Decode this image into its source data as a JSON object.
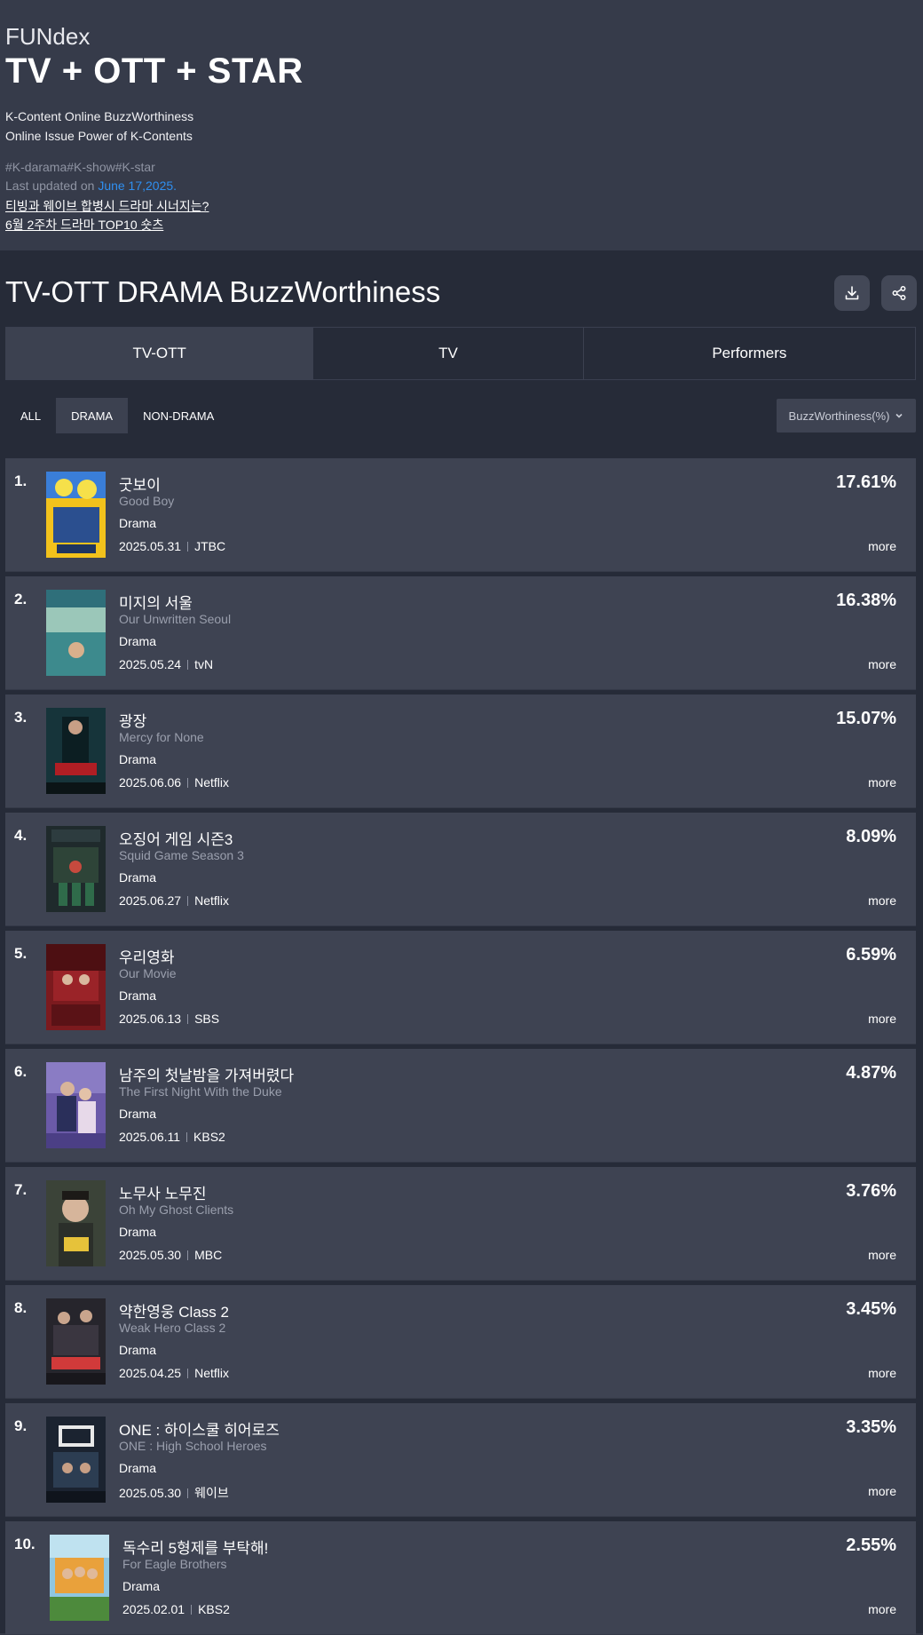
{
  "header": {
    "brand": "FUNdex",
    "title": "TV + OTT + STAR",
    "subtitle_1": "K-Content Online BuzzWorthiness",
    "subtitle_2": "Online Issue Power of K-Contents",
    "tags": "#K-darama#K-show#K-star",
    "updated_prefix": "Last updated on ",
    "updated_date": "June 17,2025.",
    "link_1": "티빙과 웨이브 합병시 드라마 시너지는?",
    "link_2": "6월 2주차 드라마 TOP10 숏츠"
  },
  "board": {
    "title": "TV-OTT DRAMA BuzzWorthiness",
    "download_icon": "download-icon",
    "share_icon": "share-icon",
    "main_tabs": [
      "TV-OTT",
      "TV",
      "Performers"
    ],
    "active_main_tab": "TV-OTT",
    "sub_tabs": [
      "ALL",
      "DRAMA",
      "NON-DRAMA"
    ],
    "active_sub_tab": "DRAMA",
    "sort_label": "BuzzWorthiness(%)"
  },
  "colors": {
    "header_bg": "#363b4a",
    "board_bg": "#262b38",
    "row_bg": "#3e4352",
    "accent_link": "#2f8ff0"
  },
  "list": {
    "more_label": "more",
    "items": [
      {
        "rank": "1.",
        "title_ko": "굿보이",
        "title_en": "Good Boy",
        "genre": "Drama",
        "date": "2025.05.31",
        "channel": "JTBC",
        "pct": "17.61%"
      },
      {
        "rank": "2.",
        "title_ko": "미지의 서울",
        "title_en": "Our Unwritten Seoul",
        "genre": "Drama",
        "date": "2025.05.24",
        "channel": "tvN",
        "pct": "16.38%"
      },
      {
        "rank": "3.",
        "title_ko": "광장",
        "title_en": "Mercy for None",
        "genre": "Drama",
        "date": "2025.06.06",
        "channel": "Netflix",
        "pct": "15.07%"
      },
      {
        "rank": "4.",
        "title_ko": "오징어 게임 시즌3",
        "title_en": "Squid Game Season 3",
        "genre": "Drama",
        "date": "2025.06.27",
        "channel": "Netflix",
        "pct": "8.09%"
      },
      {
        "rank": "5.",
        "title_ko": "우리영화",
        "title_en": "Our Movie",
        "genre": "Drama",
        "date": "2025.06.13",
        "channel": "SBS",
        "pct": "6.59%"
      },
      {
        "rank": "6.",
        "title_ko": "남주의 첫날밤을 가져버렸다",
        "title_en": "The First Night With the Duke",
        "genre": "Drama",
        "date": "2025.06.11",
        "channel": "KBS2",
        "pct": "4.87%"
      },
      {
        "rank": "7.",
        "title_ko": "노무사 노무진",
        "title_en": "Oh My Ghost Clients",
        "genre": "Drama",
        "date": "2025.05.30",
        "channel": "MBC",
        "pct": "3.76%"
      },
      {
        "rank": "8.",
        "title_ko": "약한영웅 Class 2",
        "title_en": "Weak Hero Class 2",
        "genre": "Drama",
        "date": "2025.04.25",
        "channel": "Netflix",
        "pct": "3.45%"
      },
      {
        "rank": "9.",
        "title_ko": "ONE : 하이스쿨 히어로즈",
        "title_en": "ONE : High School Heroes",
        "genre": "Drama",
        "date": "2025.05.30",
        "channel": "웨이브",
        "pct": "3.35%"
      },
      {
        "rank": "10.",
        "title_ko": "독수리 5형제를 부탁해!",
        "title_en": "For Eagle Brothers",
        "genre": "Drama",
        "date": "2025.02.01",
        "channel": "KBS2",
        "pct": "2.55%"
      }
    ]
  }
}
